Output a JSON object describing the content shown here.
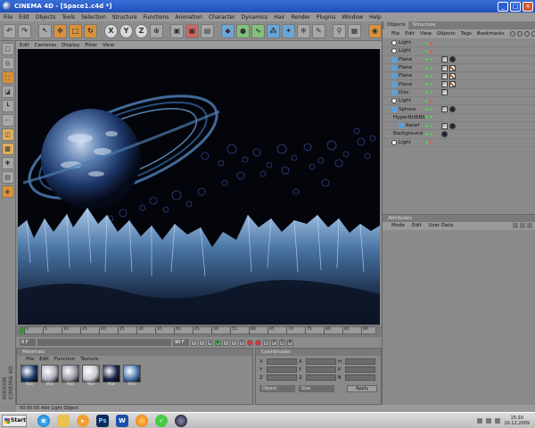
{
  "window": {
    "title": "CINEMA 4D - [Space1.c4d *]",
    "minimize_glyph": "_",
    "maximize_glyph": "□",
    "close_glyph": "×"
  },
  "menu": [
    "File",
    "Edit",
    "Objects",
    "Tools",
    "Selection",
    "Structure",
    "Functions",
    "Animation",
    "Character",
    "Dynamics",
    "Hair",
    "Render",
    "Plugins",
    "Window",
    "Help"
  ],
  "toolbar": {
    "axis_x": "X",
    "axis_y": "Y",
    "axis_z": "Z"
  },
  "viewport_menu": [
    "Edit",
    "Cameras",
    "Display",
    "Filter",
    "View"
  ],
  "timeline": {
    "ticks": [
      "0",
      "5",
      "10",
      "15",
      "20",
      "25",
      "30",
      "35",
      "40",
      "45",
      "50",
      "55",
      "60",
      "65",
      "70",
      "75",
      "80",
      "85",
      "90"
    ],
    "end_label": "0 F"
  },
  "transport": {
    "current_frame": "0 F",
    "end_frame": "90 F"
  },
  "materials": {
    "title": "Materials",
    "menu": [
      "File",
      "Edit",
      "Function",
      "Texture"
    ],
    "items": [
      {
        "label": "Mat",
        "color": "#1c3a6a"
      },
      {
        "label": "Mat",
        "color": "#b0b0c0"
      },
      {
        "label": "Mat",
        "color": "#9a9aa8"
      },
      {
        "label": "Mat",
        "color": "#c8c8d0"
      },
      {
        "label": "Mat",
        "color": "#1a2448"
      },
      {
        "label": "Mat",
        "color": "#4a78b0"
      }
    ]
  },
  "coordinates": {
    "title": "Coordinates",
    "col1": [
      "X",
      "Y",
      "Z"
    ],
    "col2": [
      "X",
      "Y",
      "Z"
    ],
    "col3": [
      "H",
      "P",
      "B"
    ],
    "mode_select": "Object",
    "size_select": "Size",
    "apply_label": "Apply"
  },
  "status": {
    "text": "00:00:05 Add Light Object"
  },
  "objects_panel": {
    "tabs": [
      "Objects",
      "Structure"
    ],
    "menu": [
      "File",
      "Edit",
      "View",
      "Objects",
      "Tags",
      "Bookmarks"
    ],
    "items": [
      {
        "name": "Light",
        "kind": "light"
      },
      {
        "name": "Light",
        "kind": "light"
      },
      {
        "name": "Plane",
        "kind": "prim"
      },
      {
        "name": "Plane",
        "kind": "prim"
      },
      {
        "name": "Plane",
        "kind": "prim"
      },
      {
        "name": "Plane",
        "kind": "prim"
      },
      {
        "name": "Disc",
        "kind": "prim"
      },
      {
        "name": "Light",
        "kind": "light"
      },
      {
        "name": "Sphere",
        "kind": "prim"
      },
      {
        "name": "HyperNURBS",
        "kind": "nurbs"
      },
      {
        "name": "Relief",
        "kind": "prim"
      },
      {
        "name": "Background",
        "kind": "prim"
      },
      {
        "name": "Light",
        "kind": "light"
      }
    ]
  },
  "attributes_panel": {
    "title": "Attributes",
    "menu": [
      "Mode",
      "Edit",
      "User Data"
    ]
  },
  "branding": {
    "logo_text": "MAXON CINEMA 4D"
  },
  "taskbar": {
    "start_label": "Start",
    "ps_label": "Ps",
    "word_label": "W",
    "time": "15:20",
    "date": "10.12.2009"
  }
}
